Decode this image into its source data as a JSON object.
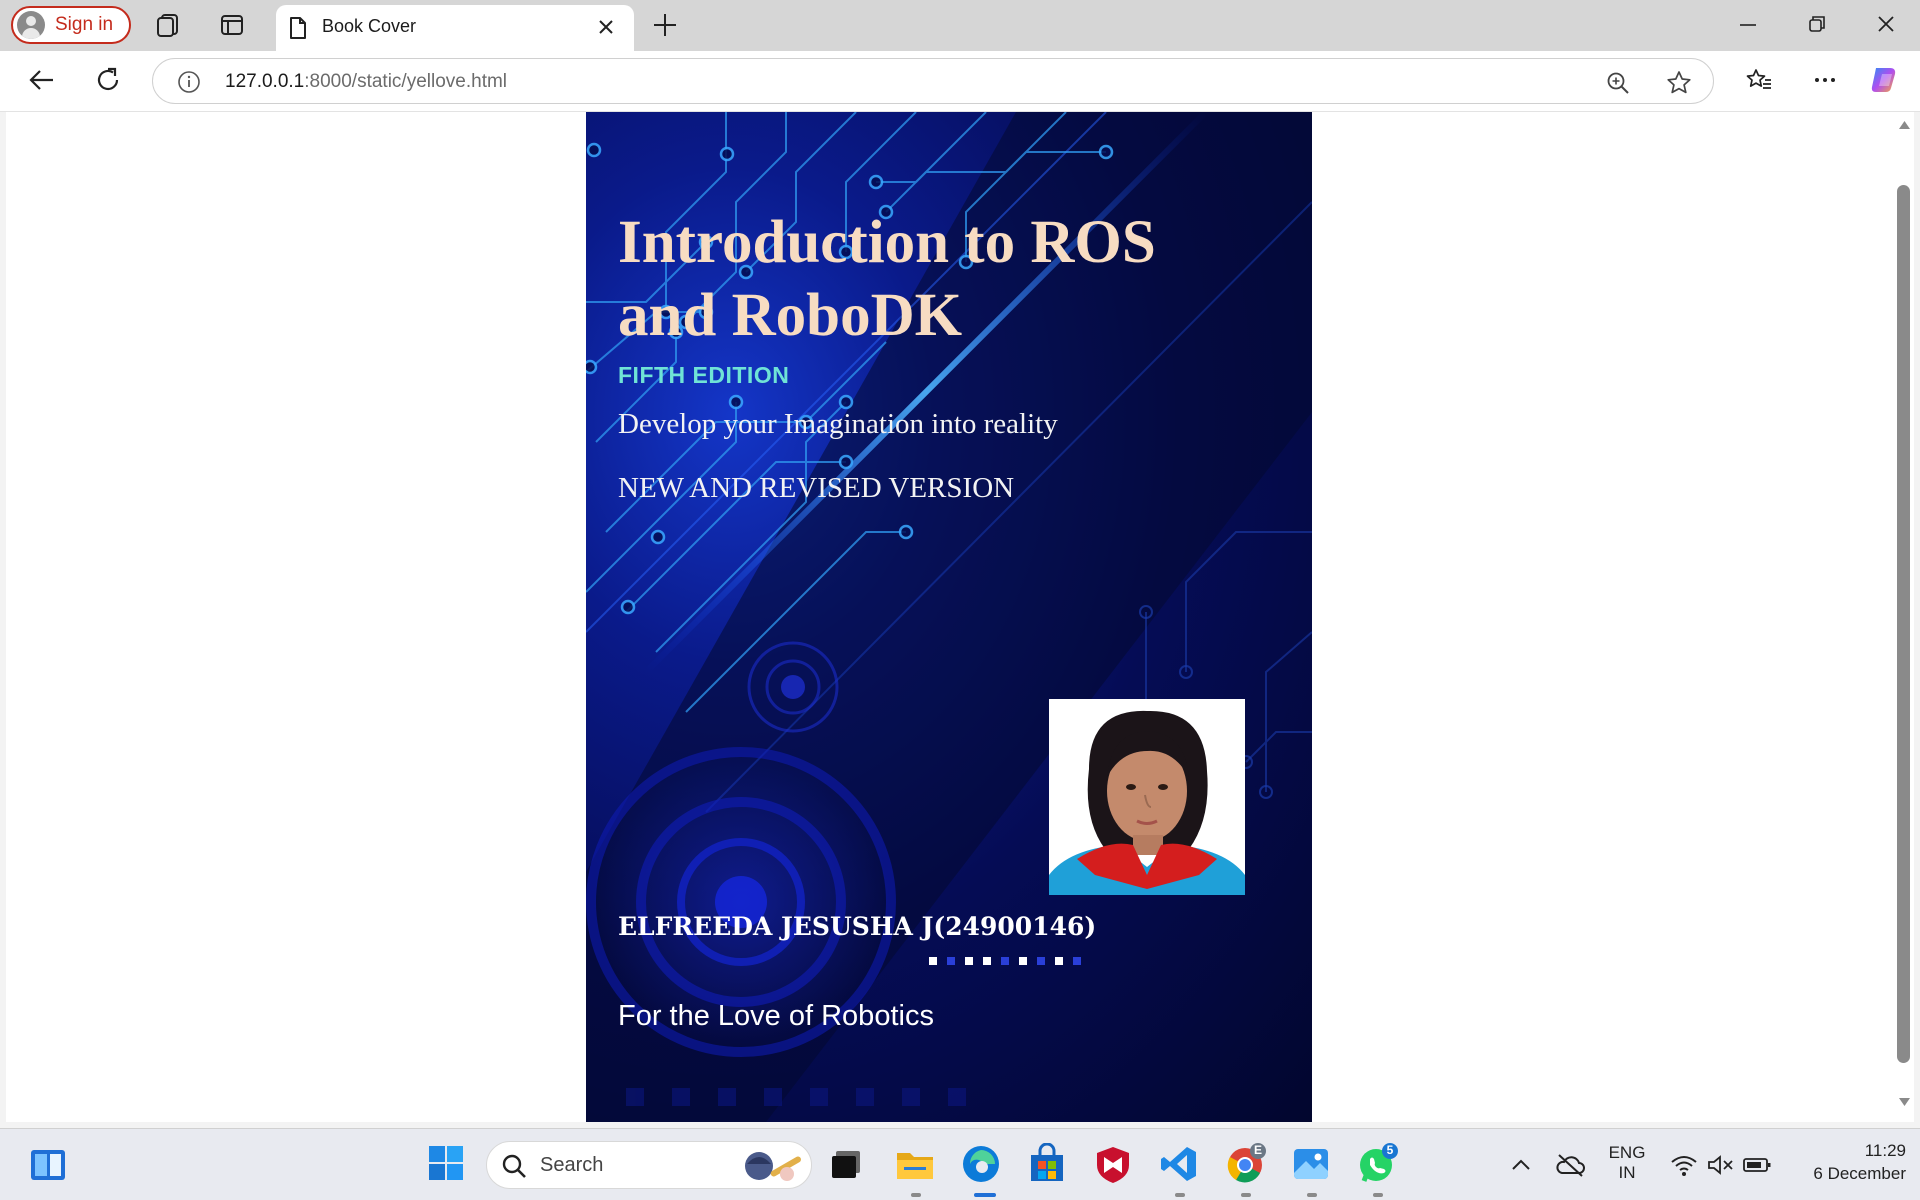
{
  "browser": {
    "signin_label": "Sign in",
    "tab_title": "Book Cover",
    "url_host": "127.0.0.1",
    "url_path": ":8000/static/yellove.html"
  },
  "cover": {
    "title": "Introduction to ROS and RoboDK",
    "edition": "FIFTH EDITION",
    "tagline": "Develop your Imagination into reality",
    "version": "NEW AND REVISED VERSION",
    "author": "ELFREEDA JESUSHA J(24900146)",
    "footer": "For the Love of Robotics",
    "dot_colors": [
      "#ffffff",
      "#2a3fd8",
      "#ffffff",
      "#ffffff",
      "#2a3fd8",
      "#ffffff",
      "#2a3fd8",
      "#ffffff",
      "#2a3fd8"
    ]
  },
  "taskbar": {
    "search_placeholder": "Search",
    "language_line1": "ENG",
    "language_line2": "IN",
    "time": "11:29",
    "date": "6 December",
    "whatsapp_badge": "5",
    "chrome_badge": "E"
  }
}
